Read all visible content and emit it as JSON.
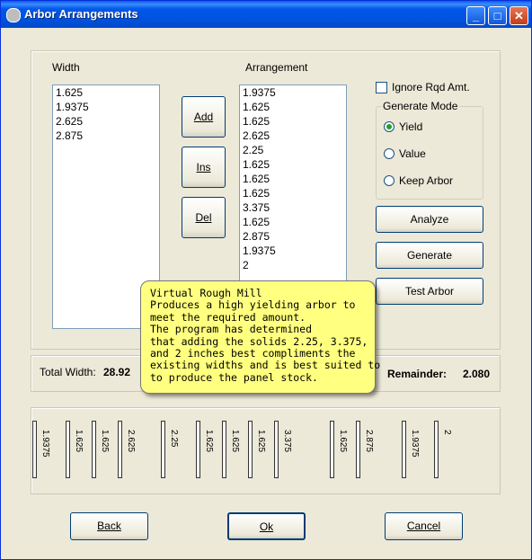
{
  "window": {
    "title": "Arbor Arrangements",
    "minimize": "_",
    "maximize": "□",
    "close": "✕"
  },
  "width_list": {
    "label": "Width",
    "items": [
      "1.625",
      "1.9375",
      "2.625",
      "2.875"
    ]
  },
  "arrangement_list": {
    "label": "Arrangement",
    "items": [
      "1.9375",
      "1.625",
      "1.625",
      "2.625",
      "2.25",
      "1.625",
      "1.625",
      "1.625",
      "3.375",
      "1.625",
      "2.875",
      "1.9375",
      "2"
    ]
  },
  "mid_buttons": {
    "add": "Add",
    "ins": "Ins",
    "del": "Del"
  },
  "ignore_checkbox": {
    "label": "Ignore Rqd Amt.",
    "checked": false
  },
  "generate_mode": {
    "title": "Generate Mode",
    "options": [
      "Yield",
      "Value",
      "Keep Arbor"
    ],
    "selected": "Yield"
  },
  "actions": {
    "analyze": "Analyze",
    "generate": "Generate",
    "test_arbor": "Test Arbor"
  },
  "totals": {
    "total_width_label": "Total Width:",
    "total_width_value": "28.92",
    "remainder_label": "Remainder:",
    "remainder_value": "2.080"
  },
  "strips": [
    "1.9375",
    "1.625",
    "1.625",
    "2.625",
    "2.25",
    "1.625",
    "1.625",
    "1.625",
    "3.375",
    "1.625",
    "2.875",
    "1.9375",
    "2"
  ],
  "tooltip": {
    "lines": [
      "Virtual Rough Mill",
      "Produces a high yielding arbor to",
      "meet the required amount.",
      "The program has determined",
      "that adding the solids 2.25, 3.375,",
      "and 2 inches best compliments the",
      "existing widths and is best suited to",
      "to produce the panel stock."
    ]
  },
  "footer": {
    "back": "Back",
    "ok": "Ok",
    "cancel": "Cancel"
  },
  "colors": {
    "title_bar": "#0054e3",
    "tooltip_bg": "#ffff80",
    "window_bg": "#ece9d8"
  }
}
